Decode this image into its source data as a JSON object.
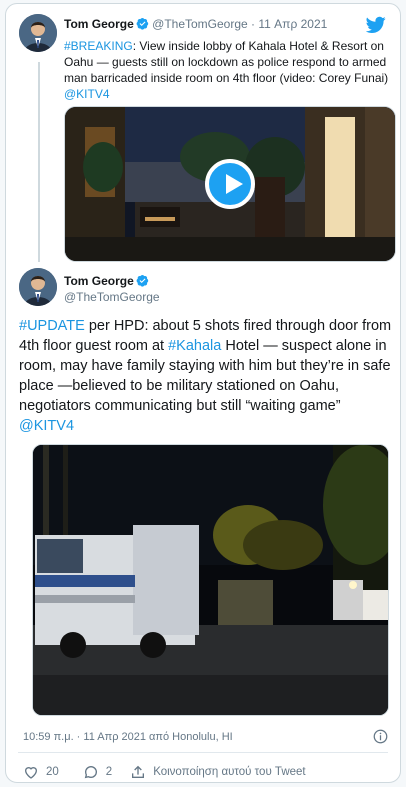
{
  "quoted_tweet": {
    "author_name": "Tom George",
    "handle": "@TheTomGeorge",
    "separator": " · ",
    "date": "11 Απρ 2021",
    "hashtag": "#BREAKING",
    "text_body": ": View inside lobby of Kahala Hotel & Resort on Oahu — guests still on lockdown as police respond to armed man barricaded inside room on 4th floor (video: Corey Funai) ",
    "mention": "@KITV4",
    "media_icon": "play-icon"
  },
  "main_tweet": {
    "author_name": "Tom George",
    "handle": "@TheTomGeorge",
    "text": {
      "hashtag1": "#UPDATE",
      "part1": " per HPD: about 5 shots fired through door from 4th floor guest room at ",
      "hashtag2": "#Kahala",
      "part2": " Hotel — suspect alone in room, may have family staying with him but they’re in safe place —believed to be military stationed on Oahu, negotiators communicating but still “waiting game” ",
      "mention": "@KITV4"
    },
    "timestamp": "10:59 π.μ. · 11 Απρ 2021 από Honolulu, HI"
  },
  "actions": {
    "likes_count": "20",
    "replies_count": "2",
    "share_label": "Κοινοποίηση αυτού του Tweet"
  },
  "colors": {
    "link": "#1b95e0",
    "brand": "#1da1f2",
    "muted": "#657786",
    "like_red": "#e0245e"
  }
}
